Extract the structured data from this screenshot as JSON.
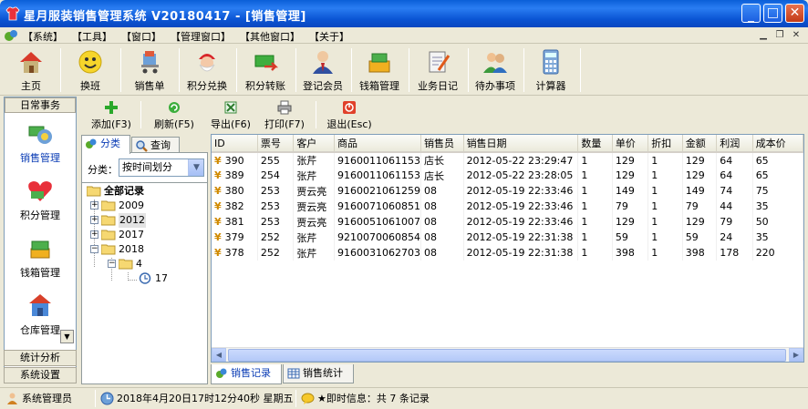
{
  "window": {
    "title": "星月服装销售管理系统 V20180417 - [销售管理]",
    "colors": {
      "titlebar": "#0b55d4",
      "accent": "#0a3cb5"
    }
  },
  "menu": {
    "items": [
      "【系统】",
      "【工具】",
      "【窗口】",
      "【管理窗口】",
      "【其他窗口】",
      "【关于】"
    ]
  },
  "toolbar": {
    "buttons": [
      {
        "label": "主页",
        "icon": "house-icon"
      },
      {
        "label": "换班",
        "icon": "smiley-icon"
      },
      {
        "label": "销售单",
        "icon": "shopping-cart-icon"
      },
      {
        "label": "积分兑换",
        "icon": "santa-icon"
      },
      {
        "label": "积分转账",
        "icon": "money-transfer-icon"
      },
      {
        "label": "登记会员",
        "icon": "member-icon"
      },
      {
        "label": "钱箱管理",
        "icon": "cash-box-icon"
      },
      {
        "label": "业务日记",
        "icon": "journal-icon"
      },
      {
        "label": "待办事项",
        "icon": "todo-users-icon"
      },
      {
        "label": "计算器",
        "icon": "calculator-icon"
      }
    ]
  },
  "leftnav": {
    "header": "日常事务",
    "items": [
      {
        "label": "销售管理",
        "icon": "sales-icon"
      },
      {
        "label": "积分管理",
        "icon": "heart-points-icon"
      },
      {
        "label": "钱箱管理",
        "icon": "cash-stack-icon"
      },
      {
        "label": "仓库管理",
        "icon": "warehouse-icon"
      }
    ],
    "sections": [
      "统计分析",
      "系统设置"
    ]
  },
  "subtoolbar": {
    "buttons": [
      {
        "label": "添加(F3)",
        "icon": "add-icon"
      },
      {
        "label": "刷新(F5)",
        "icon": "refresh-icon"
      },
      {
        "label": "导出(F6)",
        "icon": "export-excel-icon"
      },
      {
        "label": "打印(F7)",
        "icon": "printer-icon"
      },
      {
        "label": "退出(Esc)",
        "icon": "exit-icon"
      }
    ]
  },
  "treepanel": {
    "tabs": [
      "分类",
      "查询"
    ],
    "filter_label": "分类：",
    "filter_value": "按时间划分",
    "nodes": {
      "root": "全部记录",
      "y2009": "2009",
      "y2012": "2012",
      "y2017": "2017",
      "y2018": "2018",
      "m4": "4",
      "d17": "17"
    }
  },
  "grid": {
    "columns": [
      "ID",
      "票号",
      "客户",
      "商品",
      "销售员",
      "销售日期",
      "数量",
      "单价",
      "折扣",
      "金额",
      "利润",
      "成本价"
    ],
    "rows": [
      [
        "390",
        "255",
        "张芹",
        "9160011061153",
        "店长",
        "2012-05-22 23:29:47",
        "1",
        "129",
        "1",
        "129",
        "64",
        "65"
      ],
      [
        "389",
        "254",
        "张芹",
        "9160011061153",
        "店长",
        "2012-05-22 23:28:05",
        "1",
        "129",
        "1",
        "129",
        "64",
        "65"
      ],
      [
        "380",
        "253",
        "贾云亮",
        "9160021061259",
        "08",
        "2012-05-19 22:33:46",
        "1",
        "149",
        "1",
        "149",
        "74",
        "75"
      ],
      [
        "382",
        "253",
        "贾云亮",
        "9160071060851",
        "08",
        "2012-05-19 22:33:46",
        "1",
        "79",
        "1",
        "79",
        "44",
        "35"
      ],
      [
        "381",
        "253",
        "贾云亮",
        "9160051061007",
        "08",
        "2012-05-19 22:33:46",
        "1",
        "129",
        "1",
        "129",
        "79",
        "50"
      ],
      [
        "379",
        "252",
        "张芹",
        "9210070060854",
        "08",
        "2012-05-19 22:31:38",
        "1",
        "59",
        "1",
        "59",
        "24",
        "35"
      ],
      [
        "378",
        "252",
        "张芹",
        "9160031062703",
        "08",
        "2012-05-19 22:31:38",
        "1",
        "398",
        "1",
        "398",
        "178",
        "220"
      ]
    ],
    "tabs": [
      "销售记录",
      "销售统计"
    ]
  },
  "statusbar": {
    "user": "系统管理员",
    "datetime": "2018年4月20日17时12分40秒  星期五",
    "info": "★即时信息：共 7 条记录"
  }
}
